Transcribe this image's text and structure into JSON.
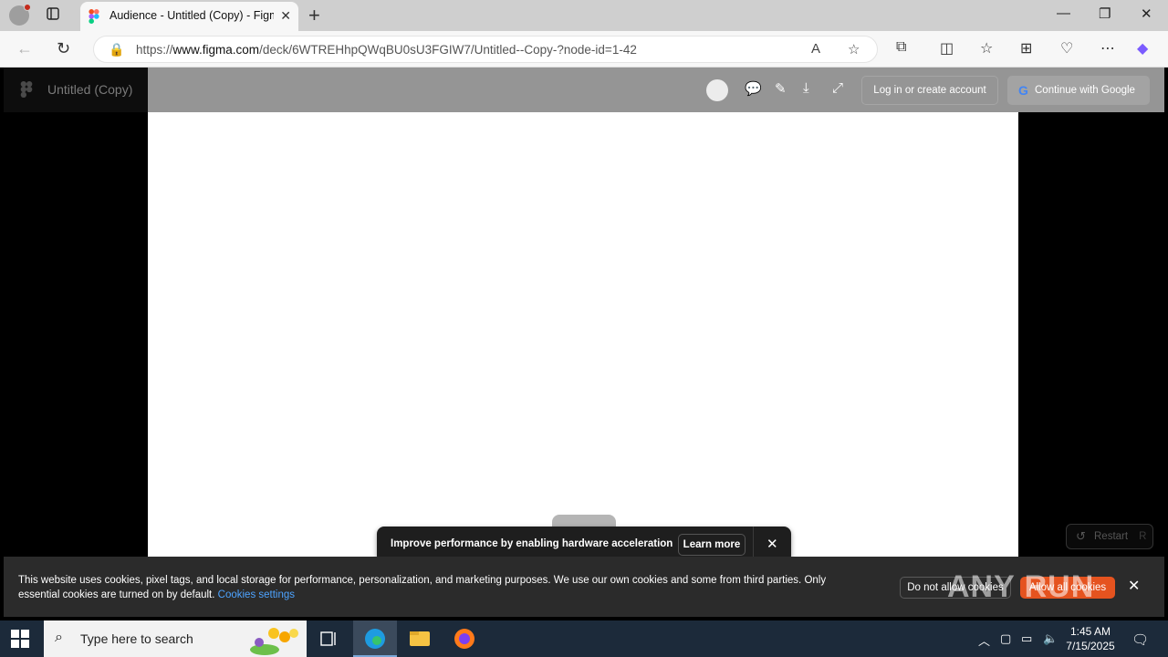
{
  "browser": {
    "tab_title": "Audience - Untitled (Copy) - Figma",
    "url_prefix": "https://",
    "url_host": "www.figma.com",
    "url_path": "/deck/6WTREHhpQWqBU0sU3FGIW7/Untitled--Copy-?node-id=1-42"
  },
  "figma": {
    "document_title": "Untitled (Copy)",
    "login_label": "Log in or create account",
    "google_label": "Continue with Google",
    "restart_label": "Restart",
    "restart_key": "R"
  },
  "toast": {
    "message": "Improve performance by enabling hardware acceleration",
    "learn_more": "Learn more"
  },
  "cookie": {
    "text": "This website uses cookies, pixel tags, and local storage for performance, personalization, and marketing purposes. We use our own cookies and some from third parties. Only essential cookies are turned on by default.",
    "settings_link": "Cookies settings",
    "deny_label": "Do not allow cookies",
    "allow_label": "Allow all cookies"
  },
  "watermark": "ANY RUN",
  "taskbar": {
    "search_placeholder": "Type here to search",
    "time": "1:45 AM",
    "date": "7/15/2025"
  },
  "colors": {
    "accent_orange": "#e5531f",
    "link_blue": "#4da3ff",
    "taskbar": "#1c2a3a"
  }
}
